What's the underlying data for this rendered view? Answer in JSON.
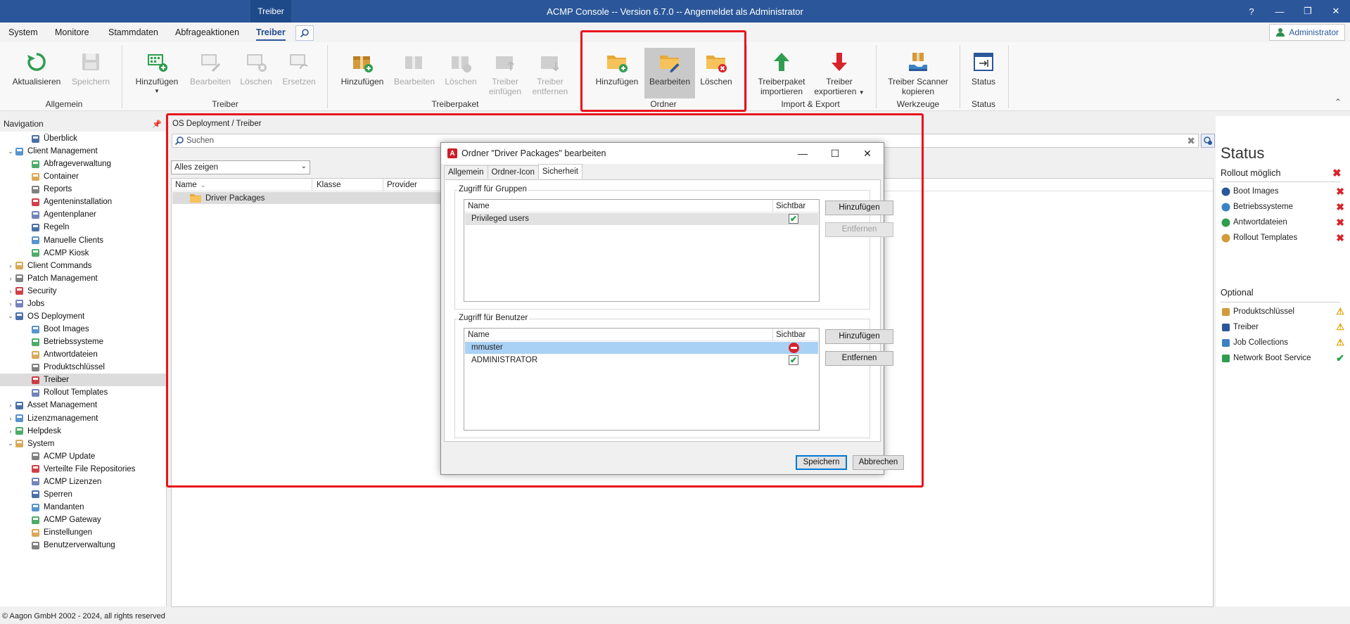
{
  "window": {
    "context_tab": "Treiber",
    "title": "ACMP Console -- Version 6.7.0 -- Angemeldet als Administrator",
    "help": "?"
  },
  "menu": {
    "tabs": [
      "System",
      "Monitore",
      "Stammdaten",
      "Abfrageaktionen",
      "Treiber"
    ],
    "active": "Treiber",
    "admin_label": "Administrator"
  },
  "ribbon": {
    "allgemein": {
      "label": "Allgemein",
      "buttons": [
        "Aktualisieren",
        "Speichern"
      ]
    },
    "treiber": {
      "label": "Treiber",
      "buttons": [
        "Hinzufügen",
        "Bearbeiten",
        "Löschen",
        "Ersetzen"
      ]
    },
    "treiberpaket": {
      "label": "Treiberpaket",
      "buttons": [
        "Hinzufügen",
        "Bearbeiten",
        "Löschen",
        "Treiber einfügen",
        "Treiber entfernen"
      ]
    },
    "ordner": {
      "label": "Ordner",
      "buttons": [
        "Hinzufügen",
        "Bearbeiten",
        "Löschen"
      ]
    },
    "import_export": {
      "label": "Import & Export",
      "buttons": [
        "Treiberpaket importieren",
        "Treiber exportieren"
      ]
    },
    "werkzeuge": {
      "label": "Werkzeuge",
      "buttons": [
        "Treiber Scanner kopieren"
      ]
    },
    "status": {
      "label": "Status",
      "buttons": [
        "Status"
      ]
    }
  },
  "nav": {
    "header": "Navigation",
    "items": [
      {
        "label": "Überblick",
        "level": 1,
        "exp": ""
      },
      {
        "label": "Client Management",
        "level": 0,
        "exp": "v"
      },
      {
        "label": "Abfrageverwaltung",
        "level": 1,
        "exp": ""
      },
      {
        "label": "Container",
        "level": 1,
        "exp": ""
      },
      {
        "label": "Reports",
        "level": 1,
        "exp": ""
      },
      {
        "label": "Agenteninstallation",
        "level": 1,
        "exp": ""
      },
      {
        "label": "Agentenplaner",
        "level": 1,
        "exp": ""
      },
      {
        "label": "Regeln",
        "level": 1,
        "exp": ""
      },
      {
        "label": "Manuelle Clients",
        "level": 1,
        "exp": ""
      },
      {
        "label": "ACMP Kiosk",
        "level": 1,
        "exp": ""
      },
      {
        "label": "Client Commands",
        "level": 0,
        "exp": ">"
      },
      {
        "label": "Patch Management",
        "level": 0,
        "exp": ">"
      },
      {
        "label": "Security",
        "level": 0,
        "exp": ">"
      },
      {
        "label": "Jobs",
        "level": 0,
        "exp": ">"
      },
      {
        "label": "OS Deployment",
        "level": 0,
        "exp": "v"
      },
      {
        "label": "Boot Images",
        "level": 1,
        "exp": ""
      },
      {
        "label": "Betriebssysteme",
        "level": 1,
        "exp": ""
      },
      {
        "label": "Antwortdateien",
        "level": 1,
        "exp": ""
      },
      {
        "label": "Produktschlüssel",
        "level": 1,
        "exp": ""
      },
      {
        "label": "Treiber",
        "level": 1,
        "exp": "",
        "selected": true
      },
      {
        "label": "Rollout Templates",
        "level": 1,
        "exp": ""
      },
      {
        "label": "Asset Management",
        "level": 0,
        "exp": ">"
      },
      {
        "label": "Lizenzmanagement",
        "level": 0,
        "exp": ">"
      },
      {
        "label": "Helpdesk",
        "level": 0,
        "exp": ">"
      },
      {
        "label": "System",
        "level": 0,
        "exp": "v"
      },
      {
        "label": "ACMP Update",
        "level": 1,
        "exp": ""
      },
      {
        "label": "Verteilte File Repositories",
        "level": 1,
        "exp": ""
      },
      {
        "label": "ACMP Lizenzen",
        "level": 1,
        "exp": ""
      },
      {
        "label": "Sperren",
        "level": 1,
        "exp": ""
      },
      {
        "label": "Mandanten",
        "level": 1,
        "exp": ""
      },
      {
        "label": "ACMP Gateway",
        "level": 1,
        "exp": ""
      },
      {
        "label": "Einstellungen",
        "level": 1,
        "exp": ""
      },
      {
        "label": "Benutzerverwaltung",
        "level": 1,
        "exp": ""
      }
    ]
  },
  "main": {
    "breadcrumb": "OS Deployment / Treiber",
    "search_placeholder": "Suchen",
    "filter_value": "Alles zeigen",
    "columns": [
      "Name",
      "Klasse",
      "Provider"
    ],
    "rows": [
      "Driver Packages"
    ]
  },
  "dialog": {
    "title": "Ordner \"Driver Packages\" bearbeiten",
    "tabs": [
      "Allgemein",
      "Ordner-Icon",
      "Sicherheit"
    ],
    "active_tab": "Sicherheit",
    "groups": {
      "legend": "Zugriff für Gruppen",
      "col_name": "Name",
      "col_visible": "Sichtbar",
      "rows": [
        {
          "name": "Privileged users",
          "visible": true
        }
      ],
      "add": "Hinzufügen",
      "remove": "Entfernen"
    },
    "users": {
      "legend": "Zugriff für Benutzer",
      "col_name": "Name",
      "col_visible": "Sichtbar",
      "rows": [
        {
          "name": "mmuster",
          "visible": false,
          "selected": true
        },
        {
          "name": "ADMINISTRATOR",
          "visible": true
        }
      ],
      "add": "Hinzufügen",
      "remove": "Entfernen"
    },
    "save": "Speichern",
    "cancel": "Abbrechen"
  },
  "status": {
    "title": "Status",
    "rollout_label": "Rollout möglich",
    "rollout_items": [
      "Boot Images",
      "Betriebssysteme",
      "Antwortdateien",
      "Rollout Templates"
    ],
    "optional_label": "Optional",
    "optional_items": [
      {
        "label": "Produktschlüssel",
        "state": "warning"
      },
      {
        "label": "Treiber",
        "state": "warning"
      },
      {
        "label": "Job Collections",
        "state": "warning"
      },
      {
        "label": "Network Boot Service",
        "state": "ok"
      }
    ],
    "colors": {
      "error": "#d8232a",
      "warning": "#e5a100",
      "ok": "#1ea04a"
    }
  },
  "footer": "© Aagon GmbH 2002 - 2024, all rights reserved"
}
